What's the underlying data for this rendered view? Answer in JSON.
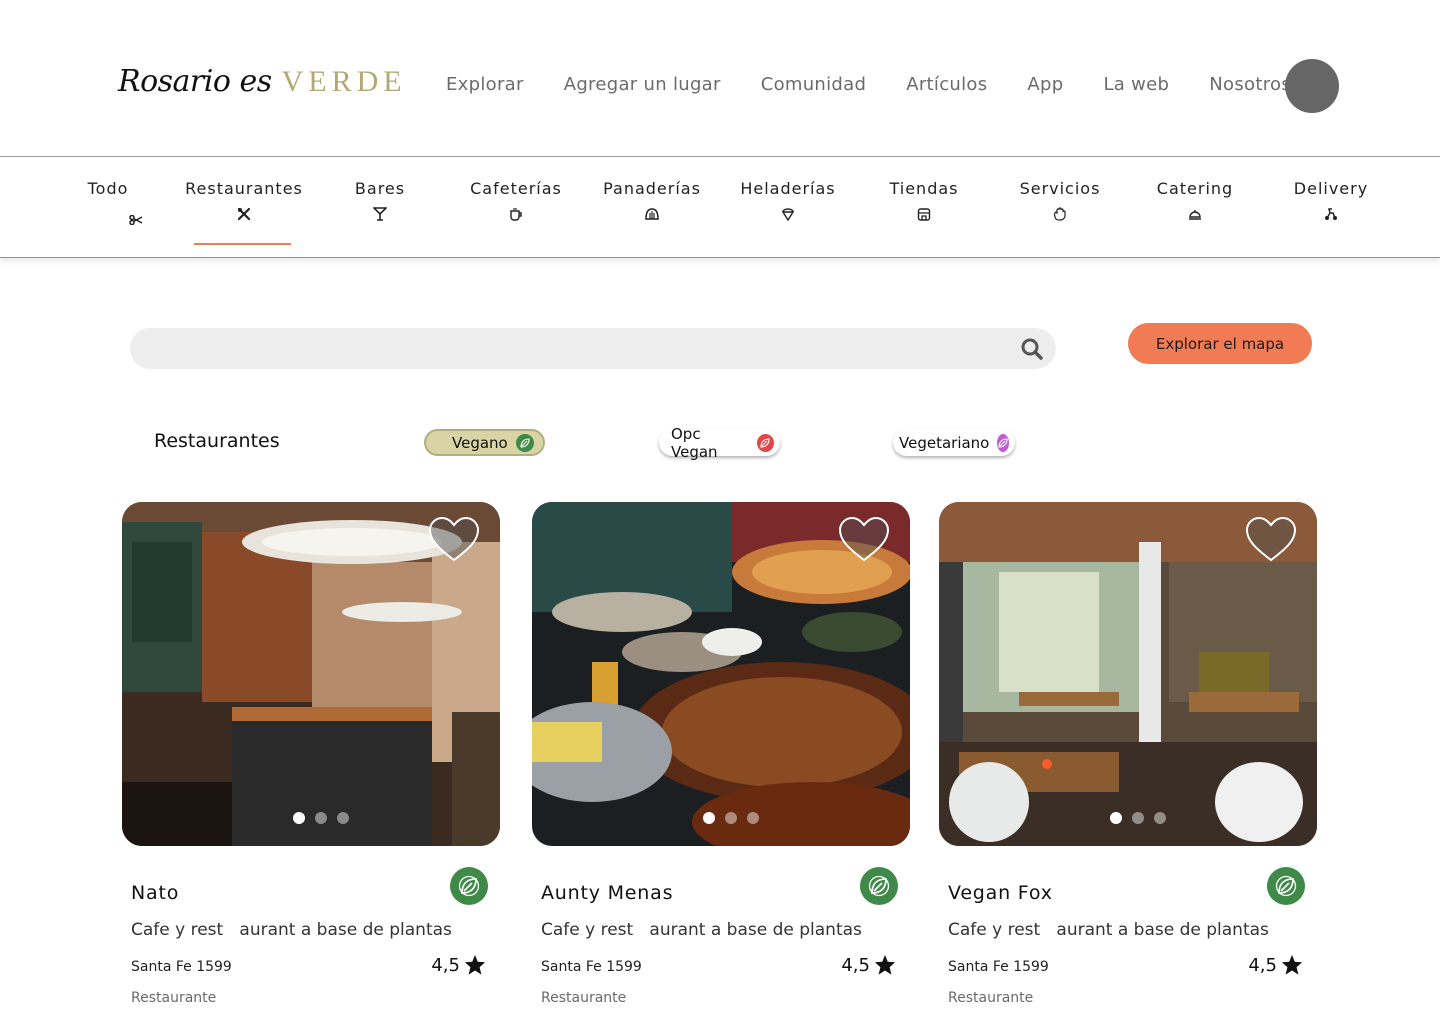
{
  "logo": {
    "script": "Rosario es",
    "brand": "VERDE"
  },
  "nav": [
    "Explorar",
    "Agregar un lugar",
    "Comunidad",
    "Artículos",
    "App",
    "La web",
    "Nosotros"
  ],
  "categories": [
    {
      "label": "Todo",
      "icon": "scissors-icon",
      "glyph": "✂"
    },
    {
      "label": "Restaurantes",
      "icon": "cutlery-icon",
      "glyph": "✗"
    },
    {
      "label": "Bares",
      "icon": "cocktail-icon",
      "glyph": "Ỿ"
    },
    {
      "label": "Cafeterías",
      "icon": "coffee-cup-icon",
      "glyph": "☕"
    },
    {
      "label": "Panaderías",
      "icon": "bread-icon",
      "glyph": "⛫"
    },
    {
      "label": "Heladerías",
      "icon": "ice-cream-icon",
      "glyph": "◈"
    },
    {
      "label": "Tiendas",
      "icon": "store-icon",
      "glyph": "▦"
    },
    {
      "label": "Servicios",
      "icon": "hand-icon",
      "glyph": "✋"
    },
    {
      "label": "Catering",
      "icon": "cloche-icon",
      "glyph": "⌂"
    },
    {
      "label": "Delivery",
      "icon": "scooter-icon",
      "glyph": "⛟"
    }
  ],
  "active_category": "Restaurantes",
  "search": {
    "placeholder": ""
  },
  "map_button": "Explorar el mapa",
  "section_title": "Restaurantes",
  "filters": [
    {
      "label": "Vegano",
      "color": "#3f8a48",
      "active": true
    },
    {
      "label": "Opc Vegan",
      "color": "#e04848",
      "active": false
    },
    {
      "label": "Vegetariano",
      "color": "#c05ad6",
      "active": false
    }
  ],
  "cards": [
    {
      "name": "Nato",
      "description": "Cafe y rest   aurant a base de plantas",
      "address": "Santa Fe 1599",
      "rating": "4,5",
      "type": "Restaurante",
      "photo": "cafe-interior"
    },
    {
      "name": "Aunty Menas",
      "description": "Cafe y rest   aurant a base de plantas",
      "address": "Santa Fe 1599",
      "rating": "4,5",
      "type": "Restaurante",
      "photo": "food-trays"
    },
    {
      "name": "Vegan Fox",
      "description": "Cafe y rest   aurant a base de plantas",
      "address": "Santa Fe 1599",
      "rating": "4,5",
      "type": "Restaurante",
      "photo": "dining-room"
    }
  ],
  "colors": {
    "accent": "#f07b55",
    "brand": "#b2a873",
    "badge": "#3f8a48",
    "avatar": "#666666"
  }
}
